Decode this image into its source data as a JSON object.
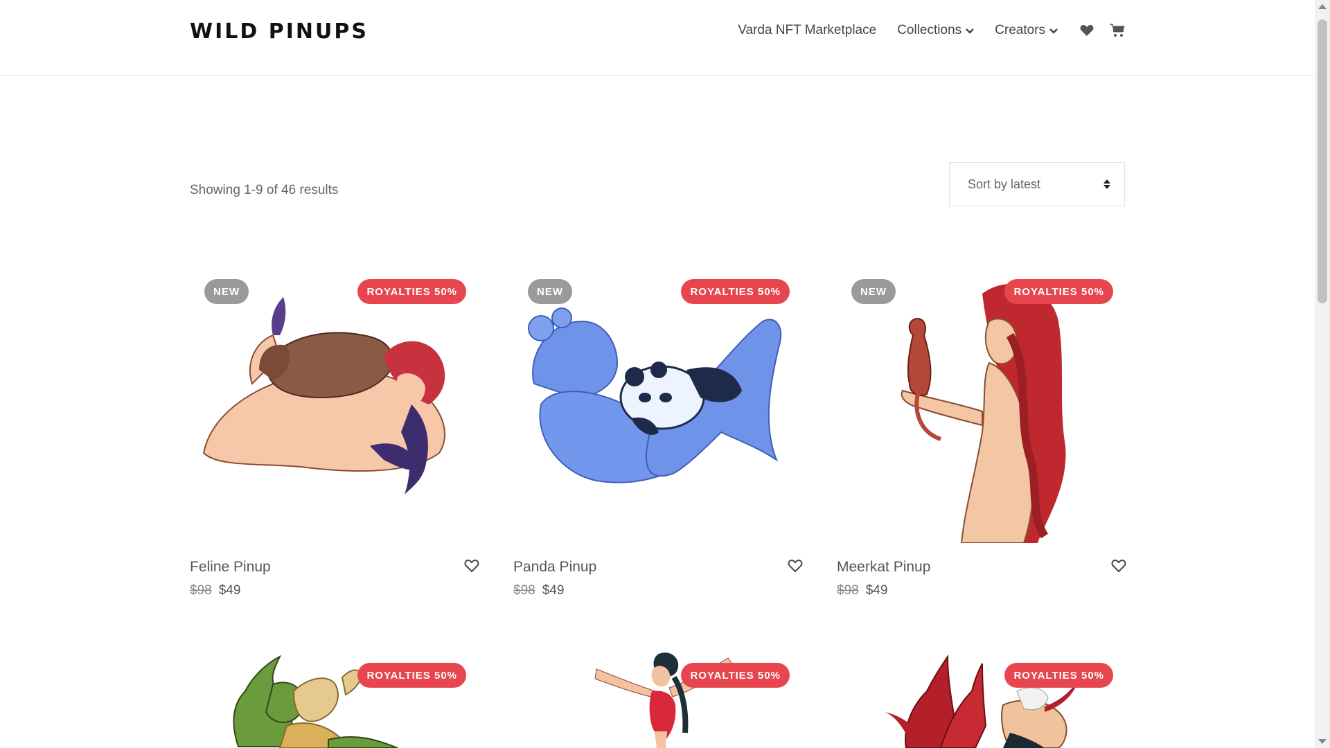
{
  "header": {
    "brand": "WILD PINUPS",
    "nav": {
      "marketplace": "Varda NFT Marketplace",
      "collections": "Collections",
      "creators": "Creators"
    },
    "icons": [
      "heart-icon",
      "cart-icon",
      "chevron-down-icon"
    ]
  },
  "toolbar": {
    "results": "Showing 1-9 of 46 results",
    "sort": "Sort by latest"
  },
  "colors": {
    "badge_royalties": "#e8464f",
    "badge_new": "#9a9a9a",
    "brand_text": "#111111"
  },
  "products": [
    {
      "title": "Feline Pinup",
      "old_price": "$98",
      "price": "$49",
      "badge_new": "NEW",
      "badge_royalties": "ROYALTIES 50%"
    },
    {
      "title": "Panda Pinup",
      "old_price": "$98",
      "price": "$49",
      "badge_new": "NEW",
      "badge_royalties": "ROYALTIES 50%"
    },
    {
      "title": "Meerkat Pinup",
      "old_price": "$98",
      "price": "$49",
      "badge_new": "NEW",
      "badge_royalties": "ROYALTIES 50%"
    },
    {
      "badge_royalties": "ROYALTIES 50%"
    },
    {
      "badge_royalties": "ROYALTIES 50%"
    },
    {
      "badge_royalties": "ROYALTIES 50%"
    }
  ]
}
